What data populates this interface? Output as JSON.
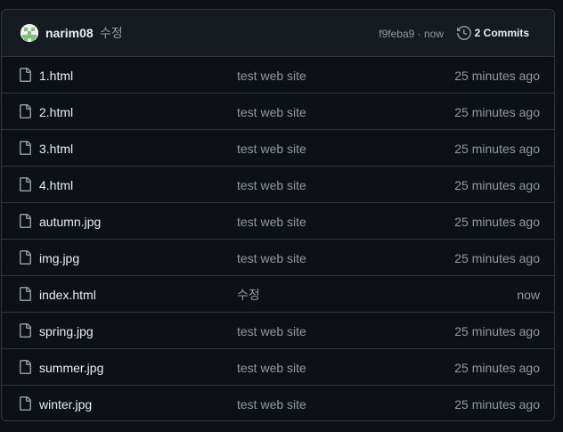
{
  "header": {
    "author": "narim08",
    "commit_message": "수정",
    "commit_meta": "f9feba9 · now",
    "commits_label": "2 Commits",
    "avatar_icon": "identicon-avatar",
    "history_icon": "history-icon"
  },
  "files": [
    {
      "name": "1.html",
      "message": "test web site",
      "time": "25 minutes ago",
      "icon": "file-icon"
    },
    {
      "name": "2.html",
      "message": "test web site",
      "time": "25 minutes ago",
      "icon": "file-icon"
    },
    {
      "name": "3.html",
      "message": "test web site",
      "time": "25 minutes ago",
      "icon": "file-icon"
    },
    {
      "name": "4.html",
      "message": "test web site",
      "time": "25 minutes ago",
      "icon": "file-icon"
    },
    {
      "name": "autumn.jpg",
      "message": "test web site",
      "time": "25 minutes ago",
      "icon": "file-icon"
    },
    {
      "name": "img.jpg",
      "message": "test web site",
      "time": "25 minutes ago",
      "icon": "file-icon"
    },
    {
      "name": "index.html",
      "message": "수정",
      "time": "now",
      "icon": "file-icon"
    },
    {
      "name": "spring.jpg",
      "message": "test web site",
      "time": "25 minutes ago",
      "icon": "file-icon"
    },
    {
      "name": "summer.jpg",
      "message": "test web site",
      "time": "25 minutes ago",
      "icon": "file-icon"
    },
    {
      "name": "winter.jpg",
      "message": "test web site",
      "time": "25 minutes ago",
      "icon": "file-icon"
    }
  ],
  "colors": {
    "background": "#0d1117",
    "header_background": "#161b22",
    "border": "#30363d",
    "text_primary": "#e6edf3",
    "text_muted": "#9198a1",
    "avatar_green": "#7ec27e"
  }
}
